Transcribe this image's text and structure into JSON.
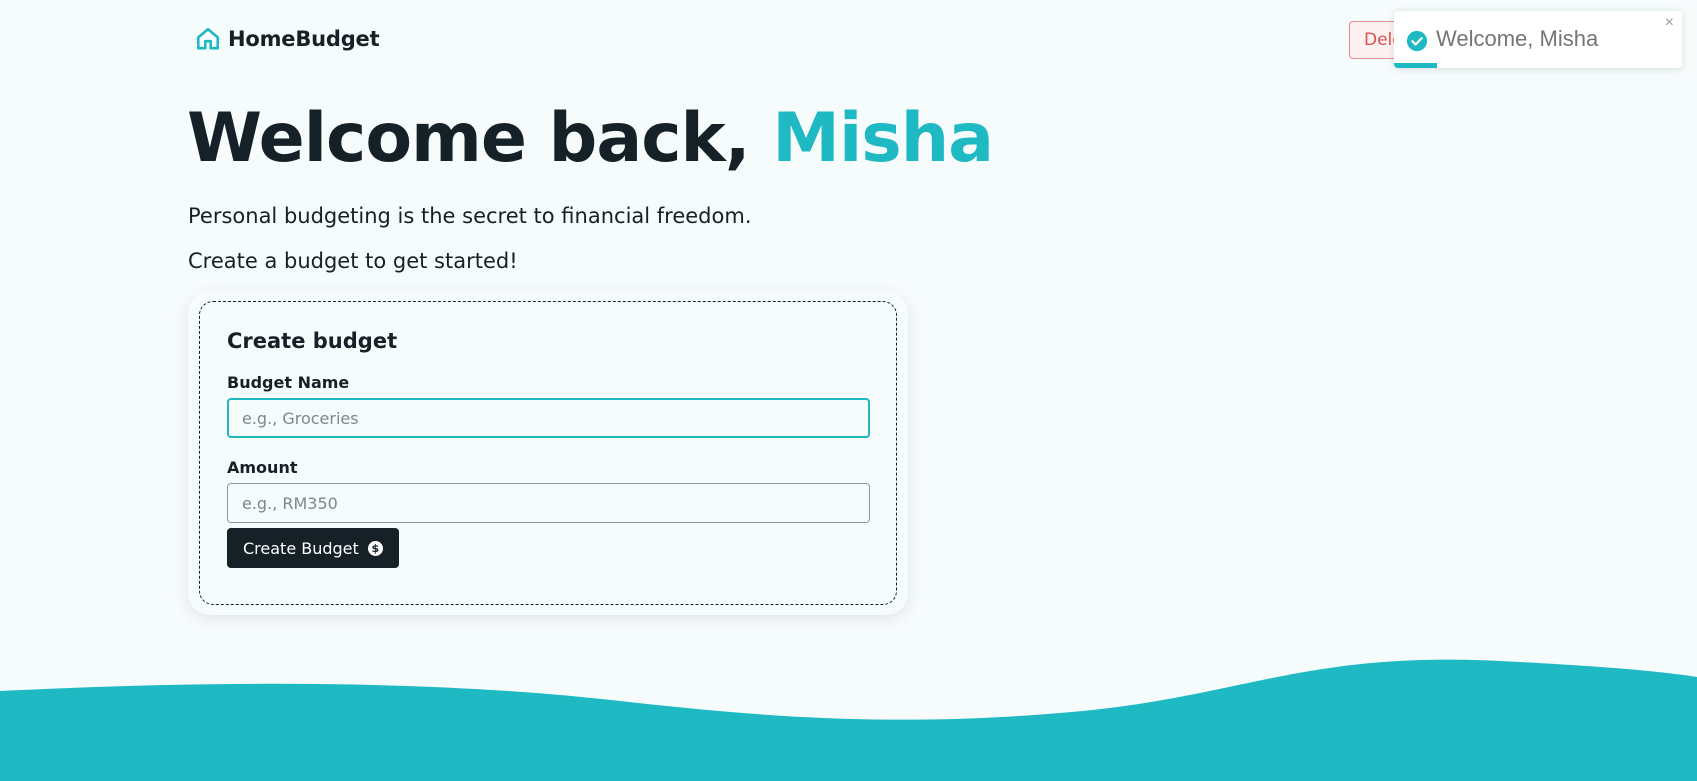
{
  "app": {
    "name": "HomeBudget",
    "logo_icon": "home-icon"
  },
  "header": {
    "delete_label": "Delete User",
    "delete_icon": "trash-icon"
  },
  "toast": {
    "message": "Welcome, Misha",
    "close": "×",
    "status_icon": "check-circle-icon",
    "progress_fraction": 0.15
  },
  "hero": {
    "greeting": "Welcome back, ",
    "username": "Misha",
    "tagline": "Personal budgeting is the secret to financial freedom.",
    "cta": "Create a budget to get started!"
  },
  "form": {
    "title": "Create budget",
    "budget_name_label": "Budget Name",
    "budget_name_placeholder": "e.g., Groceries",
    "amount_label": "Amount",
    "amount_placeholder": "e.g., RM350",
    "submit_label": "Create Budget",
    "submit_icon": "dollar-circle-icon"
  },
  "colors": {
    "accent": "#1fb9c4",
    "dark": "#152126",
    "background": "#f6fbfb",
    "danger": "#d9534f"
  }
}
